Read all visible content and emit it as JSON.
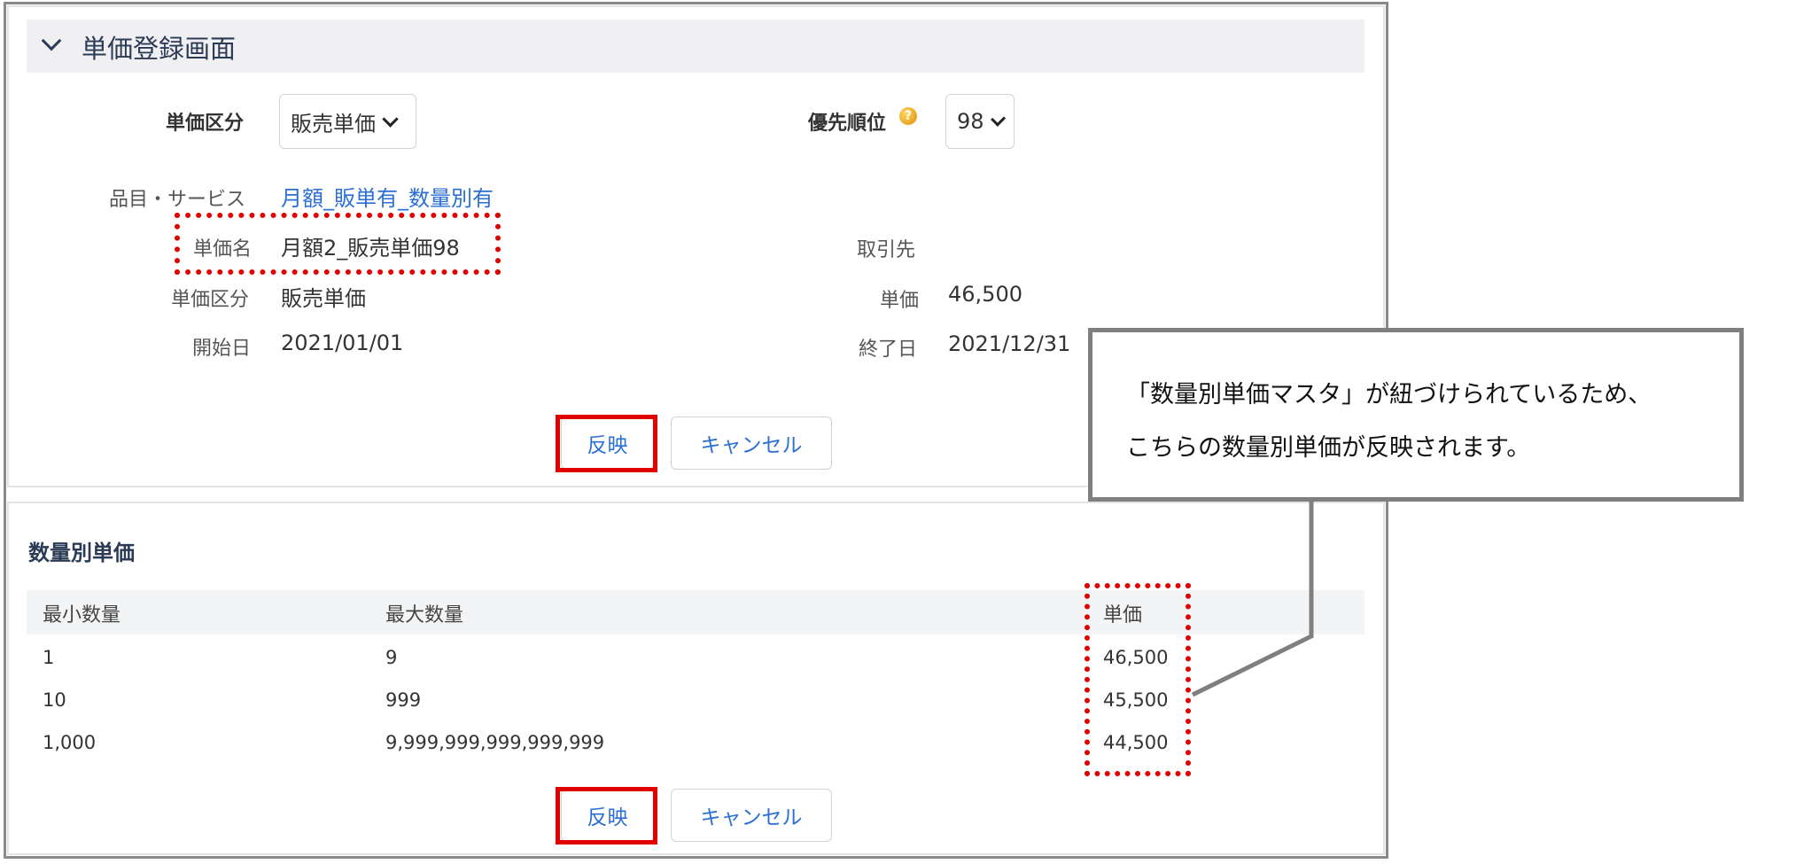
{
  "form": {
    "section_title": "単価登録画面",
    "price_type_label": "単価区分",
    "price_type_value": "販売単価",
    "priority_label": "優先順位",
    "priority_value": "98",
    "item_label": "品目・サービス",
    "item_value": "月額_販単有_数量別有",
    "price_name_label": "単価名",
    "price_name_value": "月額2_販売単価98",
    "partner_label": "取引先",
    "partner_value": "",
    "price_type2_label": "単価区分",
    "price_type2_value": "販売単価",
    "unit_price_label": "単価",
    "unit_price_value": "46,500",
    "start_label": "開始日",
    "start_value": "2021/01/01",
    "end_label": "終了日",
    "end_value": "2021/12/31",
    "apply_label": "反映",
    "cancel_label": "キャンセル"
  },
  "quantity_table": {
    "title": "数量別単価",
    "columns": [
      "最小数量",
      "最大数量",
      "単価"
    ],
    "rows": [
      [
        "1",
        "9",
        "46,500"
      ],
      [
        "10",
        "999",
        "45,500"
      ],
      [
        "1,000",
        "9,999,999,999,999,999",
        "44,500"
      ]
    ],
    "apply_label": "反映",
    "cancel_label": "キャンセル"
  },
  "callout": {
    "line1": "「数量別単価マスタ」が紐づけられているため、",
    "line2": "こちらの数量別単価が反映されます。"
  },
  "colors": {
    "highlight": "#e00000",
    "link": "#2a6fd6",
    "heading": "#2b3a55"
  },
  "icons": {
    "collapse": "chevron-down-icon",
    "help": "help-icon"
  }
}
